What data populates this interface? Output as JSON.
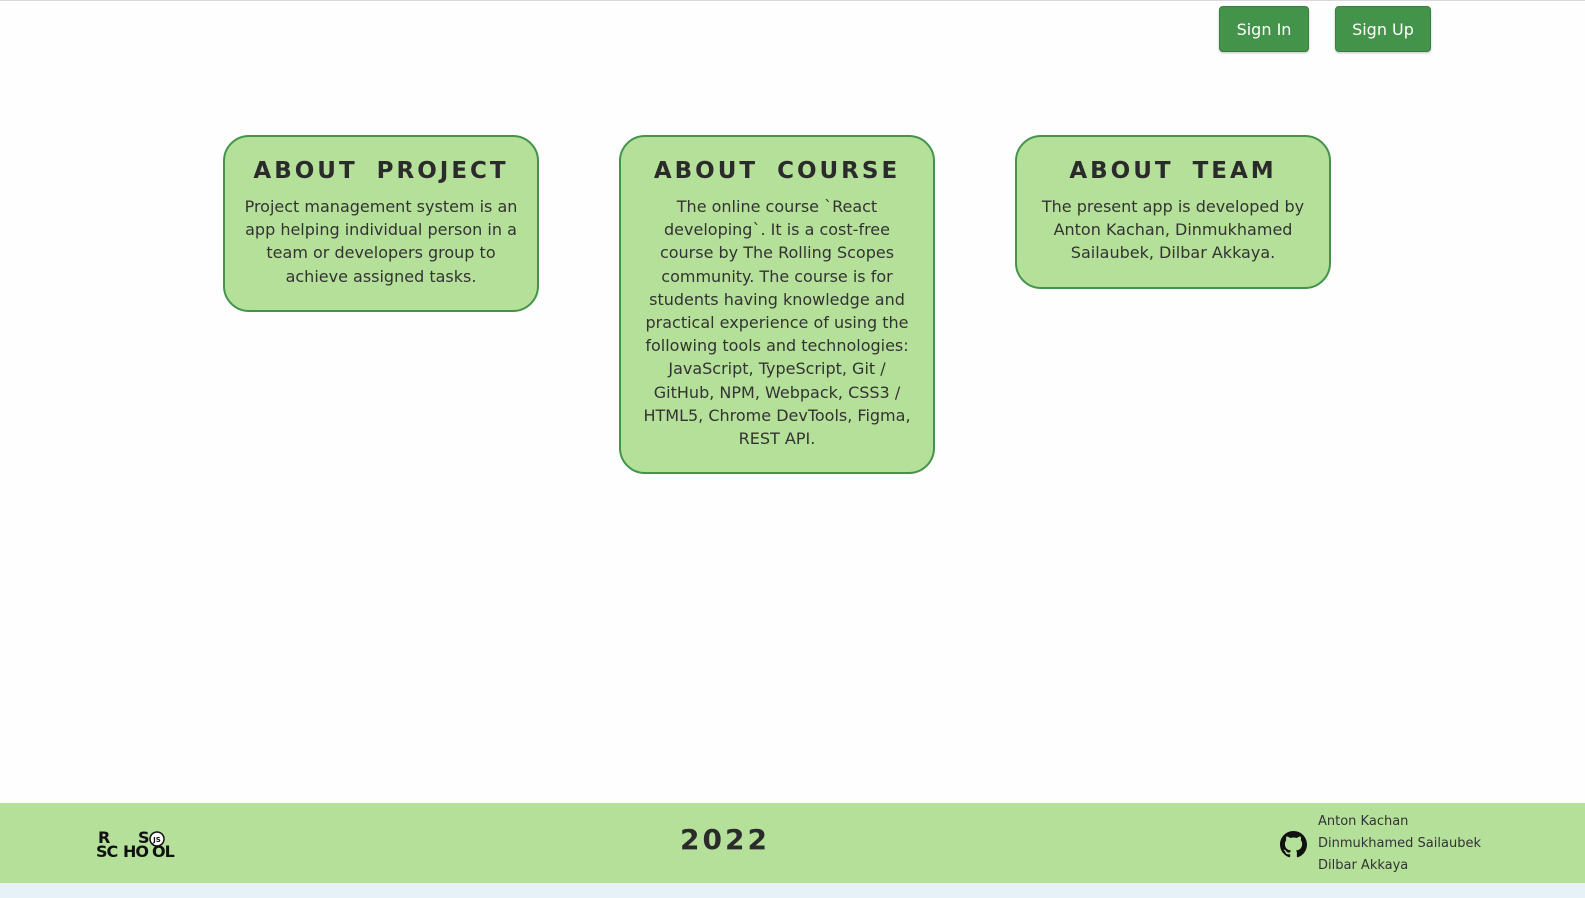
{
  "header": {
    "sign_in_label": "Sign In",
    "sign_up_label": "Sign Up"
  },
  "cards": [
    {
      "title": "ABOUT PROJECT",
      "text": "Project management system is an app helping individual person in a team or developers group to achieve assigned tasks."
    },
    {
      "title": "ABOUT COURSE",
      "text": "The online course `React developing`. It is a cost-free course by The Rolling Scopes community. The course is for students having knowledge and practical experience of using the following tools and technologies: JavaScript, TypeScript, Git / GitHub, NPM, Webpack, CSS3 / HTML5, Chrome DevTools, Figma, REST API."
    },
    {
      "title": "ABOUT TEAM",
      "text": "The present app is developed by Anton Kachan, Dinmukhamed Sailaubek, Dilbar Akkaya."
    }
  ],
  "footer": {
    "logo": {
      "r": "R",
      "s": "S",
      "sc": "SC",
      "ho": "HO",
      "ol": "OL",
      "badge": "JS"
    },
    "year": "2022",
    "github_icon": "github-icon",
    "authors": [
      "Anton Kachan",
      "Dinmukhamed Sailaubek",
      "Dilbar Akkaya"
    ]
  },
  "colors": {
    "accent": "#43934a",
    "card_bg": "#b5e09a",
    "footer_bg": "#b5e09a"
  }
}
